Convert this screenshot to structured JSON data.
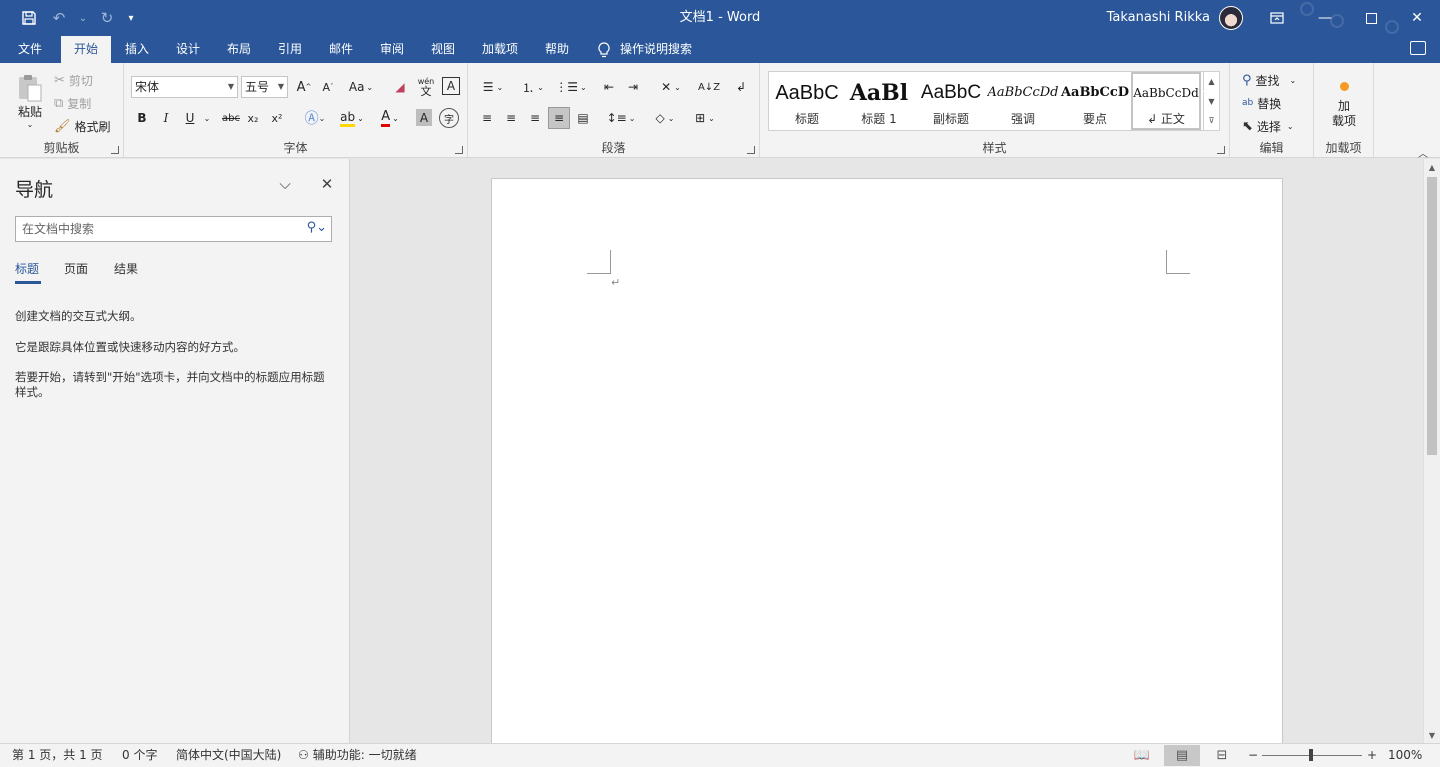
{
  "window": {
    "title": "文档1  -  Word",
    "user_name": "Takanashi Rikka"
  },
  "quick_access": {
    "save_icon": "save-icon",
    "undo_icon": "undo-icon",
    "redo_icon": "redo-icon",
    "customize_icon": "customize-qat-icon"
  },
  "tabs": [
    {
      "label": "文件"
    },
    {
      "label": "开始"
    },
    {
      "label": "插入"
    },
    {
      "label": "设计"
    },
    {
      "label": "布局"
    },
    {
      "label": "引用"
    },
    {
      "label": "邮件"
    },
    {
      "label": "审阅"
    },
    {
      "label": "视图"
    },
    {
      "label": "加载项"
    },
    {
      "label": "帮助"
    }
  ],
  "tell_me": "操作说明搜索",
  "ribbon": {
    "clipboard": {
      "paste": "粘贴",
      "cut": "剪切",
      "copy": "复制",
      "format_painter": "格式刷",
      "label": "剪贴板"
    },
    "font": {
      "font_name": "宋体",
      "font_size": "五号",
      "label": "字体",
      "change_case": "Aa",
      "bold": "B",
      "italic": "I",
      "underline": "U",
      "strikethrough": "abc",
      "subscript": "x₂",
      "superscript": "x²",
      "phonetic": "wén",
      "phonetic_sub": "文",
      "border_char": "A",
      "enclose": "字"
    },
    "paragraph": {
      "label": "段落"
    },
    "styles": {
      "label": "样式",
      "items": [
        {
          "sample": "AaBbC",
          "name": "标题"
        },
        {
          "sample": "AaBl",
          "name": "标题 1"
        },
        {
          "sample": "AaBbC",
          "name": "副标题"
        },
        {
          "sample": "AaBbCcDd",
          "name": "强调"
        },
        {
          "sample": "AaBbCcD",
          "name": "要点"
        },
        {
          "sample": "AaBbCcDd",
          "name": "↲ 正文"
        }
      ]
    },
    "editing": {
      "find": "查找",
      "replace": "替换",
      "select": "选择",
      "label": "编辑"
    },
    "addins": {
      "button_line1": "加",
      "button_line2": "载项",
      "label": "加载项"
    }
  },
  "nav_pane": {
    "title": "导航",
    "search_placeholder": "在文档中搜索",
    "tabs": [
      {
        "label": "标题"
      },
      {
        "label": "页面"
      },
      {
        "label": "结果"
      }
    ],
    "text1": "创建文档的交互式大纲。",
    "text2": "它是跟踪具体位置或快速移动内容的好方式。",
    "text3": "若要开始，请转到\"开始\"选项卡，并向文档中的标题应用标题样式。"
  },
  "document": {
    "paragraph_mark": "↵"
  },
  "status_bar": {
    "page": "第 1 页，共 1 页",
    "words": "0 个字",
    "language": "简体中文(中国大陆)",
    "accessibility": "辅助功能: 一切就绪",
    "zoom_minus": "−",
    "zoom_plus": "+",
    "zoom": "100%"
  },
  "colors": {
    "brand": "#2b579a",
    "ribbon_bg": "#f3f3f3",
    "canvas_bg": "#e6e6e6"
  }
}
